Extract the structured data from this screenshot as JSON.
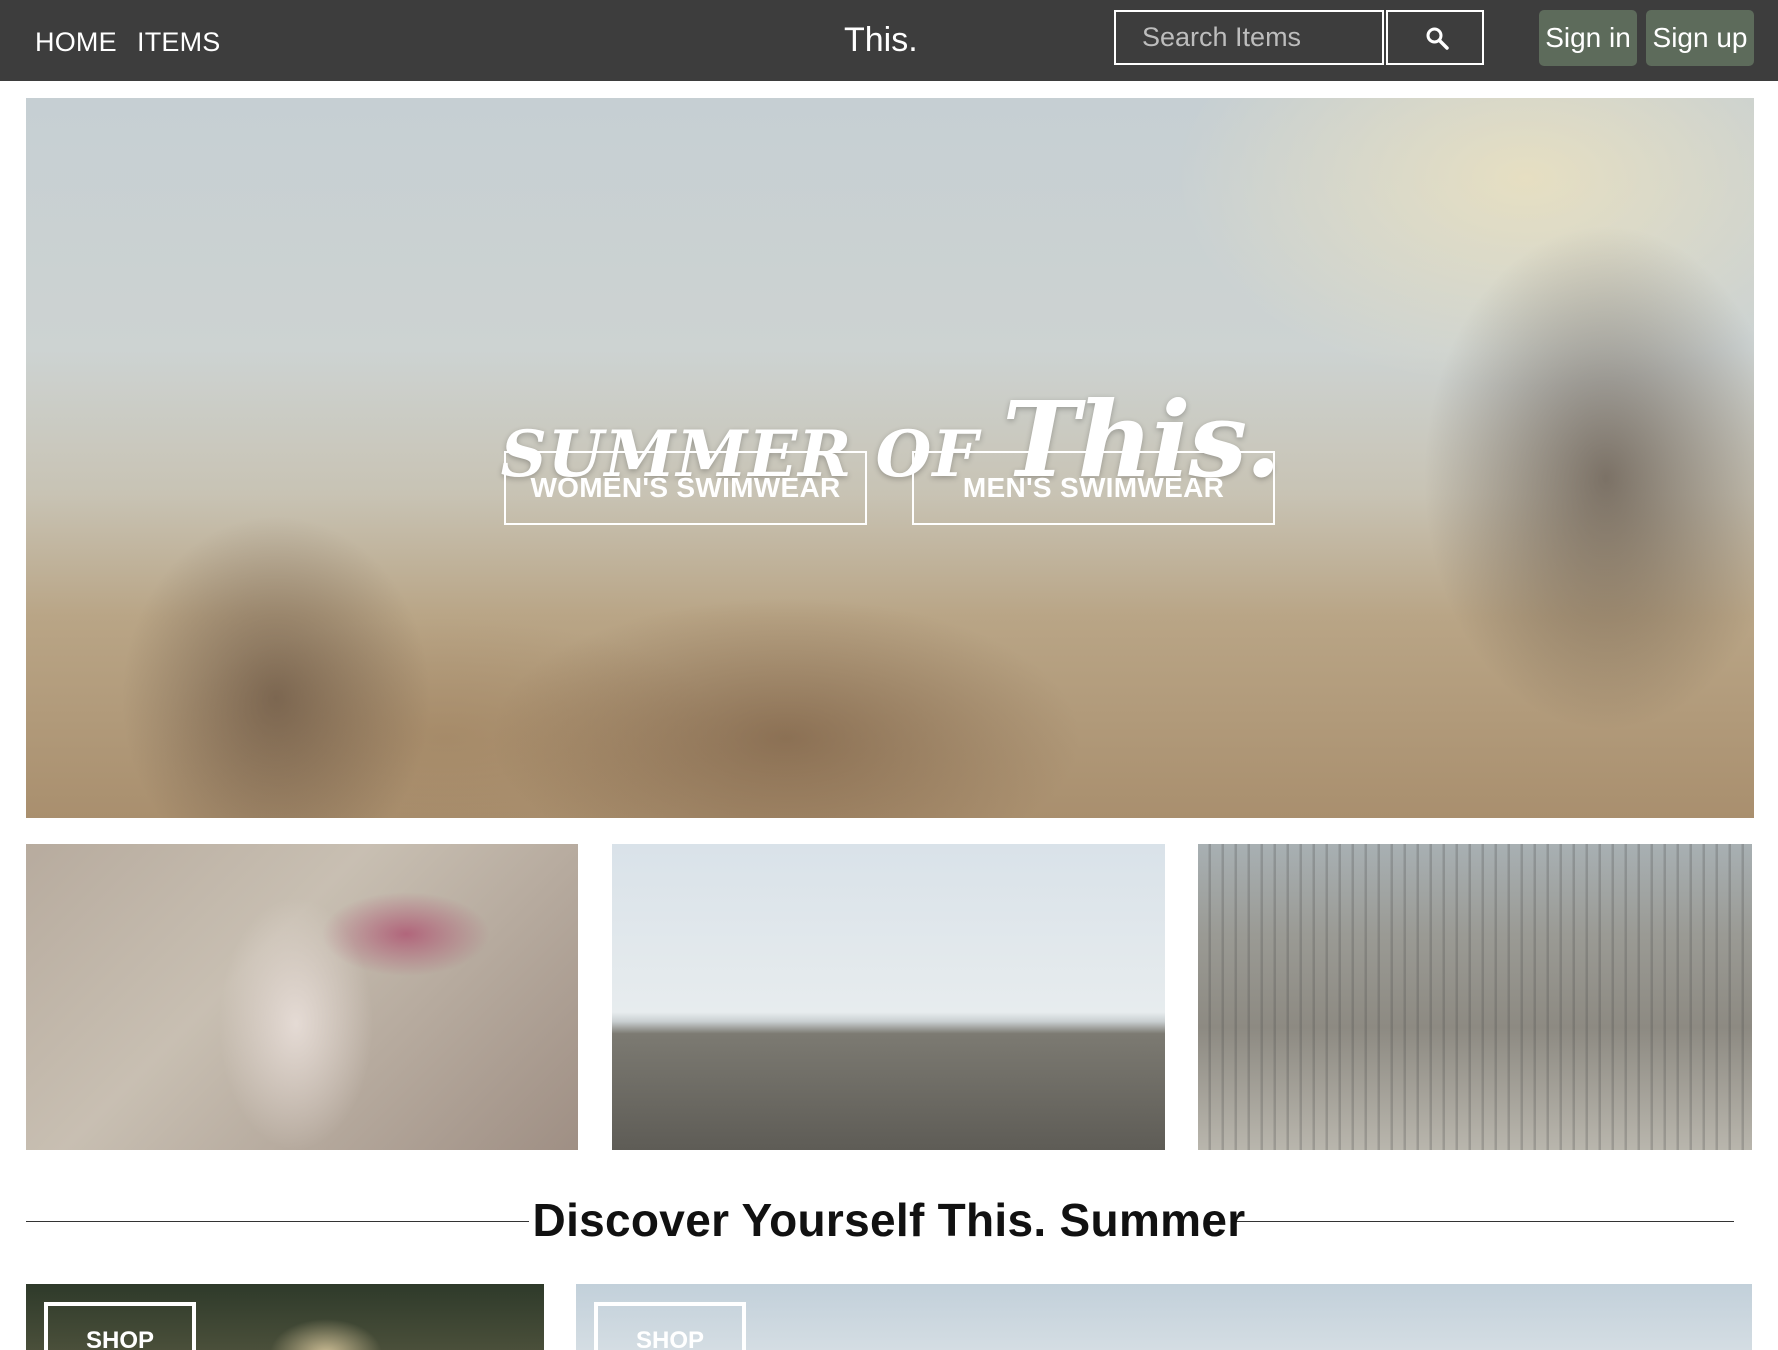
{
  "nav": {
    "home": "HOME",
    "items": "ITEMS",
    "brand": "This.",
    "search_placeholder": "Search Items",
    "sign_in": "Sign in",
    "sign_up": "Sign up"
  },
  "hero": {
    "title_part1": "SUMMER OF ",
    "title_part2": "This.",
    "womens_button": "WOMEN'S SWIMWEAR",
    "mens_button": "MEN'S SWIMWEAR"
  },
  "section": {
    "title": "Discover Yourself This. Summer"
  },
  "promos": {
    "left_button": "SHOP",
    "right_button": "SHOP"
  },
  "colors": {
    "navbar_bg": "#3d3d3d",
    "auth_button_bg": "#5d6b5b",
    "text_dark": "#111111"
  },
  "icons": {
    "search": "magnifier-icon"
  }
}
